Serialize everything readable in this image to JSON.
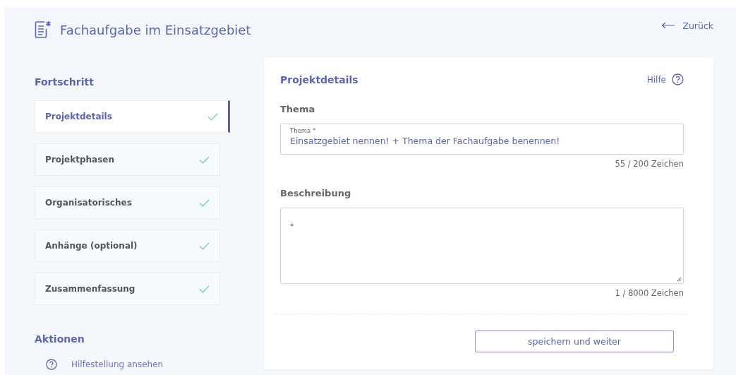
{
  "header": {
    "title": "Fachaufgabe im Einsatzgebiet",
    "back_link": "Zurück"
  },
  "progress": {
    "title": "Fortschritt",
    "steps": [
      {
        "label": "Projektdetails",
        "selected": true,
        "done": true
      },
      {
        "label": "Projektphasen",
        "selected": false,
        "done": true
      },
      {
        "label": "Organisatorisches",
        "selected": false,
        "done": true
      },
      {
        "label": "Anhänge (optional)",
        "selected": false,
        "done": true
      },
      {
        "label": "Zusammenfassung",
        "selected": false,
        "done": true
      }
    ]
  },
  "actions": {
    "title": "Aktionen",
    "items": [
      "Hilfestellung ansehen"
    ]
  },
  "form": {
    "title": "Projektdetails",
    "help": "Hilfe",
    "topic": {
      "section": "Thema",
      "label": "Thema *",
      "value": "Einsatzgebiet nennen! + Thema der Fachaufgabe benennen!",
      "counter": "55 / 200 Zeichen"
    },
    "description": {
      "section": "Beschreibung",
      "value": "*",
      "counter": "1 / 8000 Zeichen"
    },
    "submit": "speichern und weiter"
  }
}
